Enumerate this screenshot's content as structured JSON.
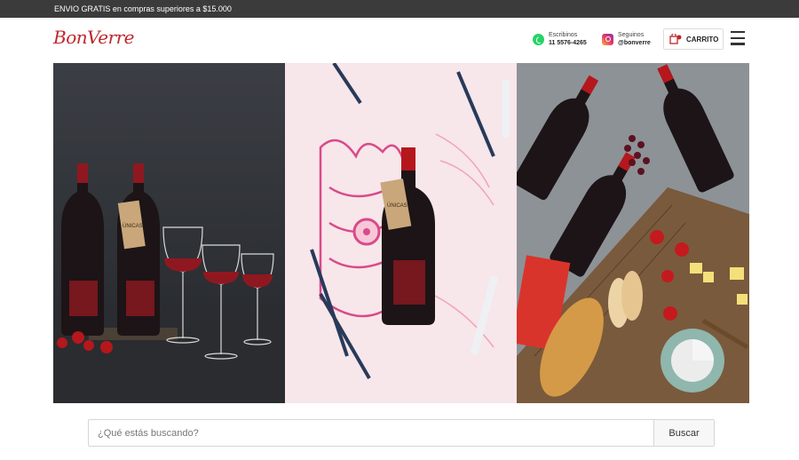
{
  "topbar": {
    "promo": "ENVIO GRATIS en compras superiores a $15.000"
  },
  "header": {
    "logo_text": "BonVerre",
    "whatsapp": {
      "label": "Escribinos",
      "value": "11 5576-4265",
      "icon": "whatsapp-icon"
    },
    "instagram": {
      "label": "Seguinos",
      "value": "@bonverre",
      "icon": "instagram-icon"
    },
    "cart_label": "CARRITO",
    "menu_icon": "hamburger-menu-icon"
  },
  "hero": {
    "panels": [
      {
        "name": "wine-bottles-and-glasses",
        "wine_label": "ÚNICAS"
      },
      {
        "name": "illustrated-bottle-on-drawing",
        "wine_label": "ÚNICAS"
      },
      {
        "name": "bottles-with-cheese-and-bread"
      }
    ]
  },
  "search": {
    "placeholder": "¿Qué estás buscando?",
    "button_label": "Buscar"
  },
  "colors": {
    "topbar": "#3b3b3b",
    "brand_red": "#c0262b",
    "wine": "#8f1820"
  }
}
